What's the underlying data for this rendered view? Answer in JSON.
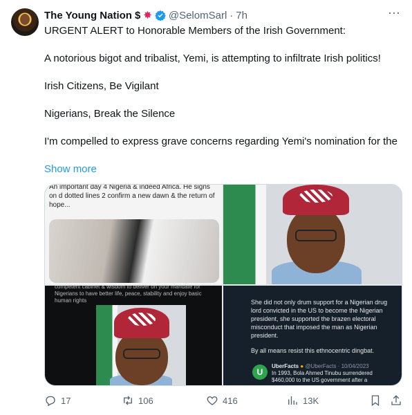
{
  "tweet": {
    "display_name": "The Young Nation",
    "name_emoji_1": "$",
    "name_emoji_2": "✸",
    "handle": "@SelomSarl",
    "separator": "·",
    "timestamp": "7h",
    "more_label": "···",
    "lines": [
      "URGENT ALERT to Honorable Members of the Irish Government:",
      "A notorious bigot and tribalist, Yemi, is attempting to infiltrate Irish politics!",
      "Irish Citizens, Be Vigilant",
      "Nigerians, Break the Silence",
      "I'm compelled to express grave concerns regarding Yemi's nomination for the"
    ],
    "show_more": "Show more"
  },
  "media": {
    "image1_caption": "An important day 4 Nigeria & indeed Africa. He signs on d dotted lines 2 confirm a new dawn & the return of hope...",
    "image3_caption": "competent cabinet & wisdom to deliver on your mandate for Nigerians to have better life, peace, stability and enjoy basic human rights",
    "image4_paragraph1": "She did not only drum support for a Nigerian drug lord convicted in the US to become the Nigerian president, she supported the brazen electoral misconduct that imposed the man as Nigerian president.",
    "image4_paragraph2": "By all means resist this ethnocentric dingbat.",
    "quote_logo": "U",
    "quote_name": "UberFacts",
    "quote_handle": "@UberFacts · 10/04/2023",
    "quote_text": "In 1993, Bola Ahmed Tinubu surrendered $460,000 to the US government after a"
  },
  "actions": {
    "replies": "17",
    "reposts": "106",
    "likes": "416",
    "views": "13K"
  },
  "colors": {
    "accent": "#1d9bf0",
    "muted": "#536471",
    "text": "#0f1419",
    "border": "#cfd9de"
  }
}
